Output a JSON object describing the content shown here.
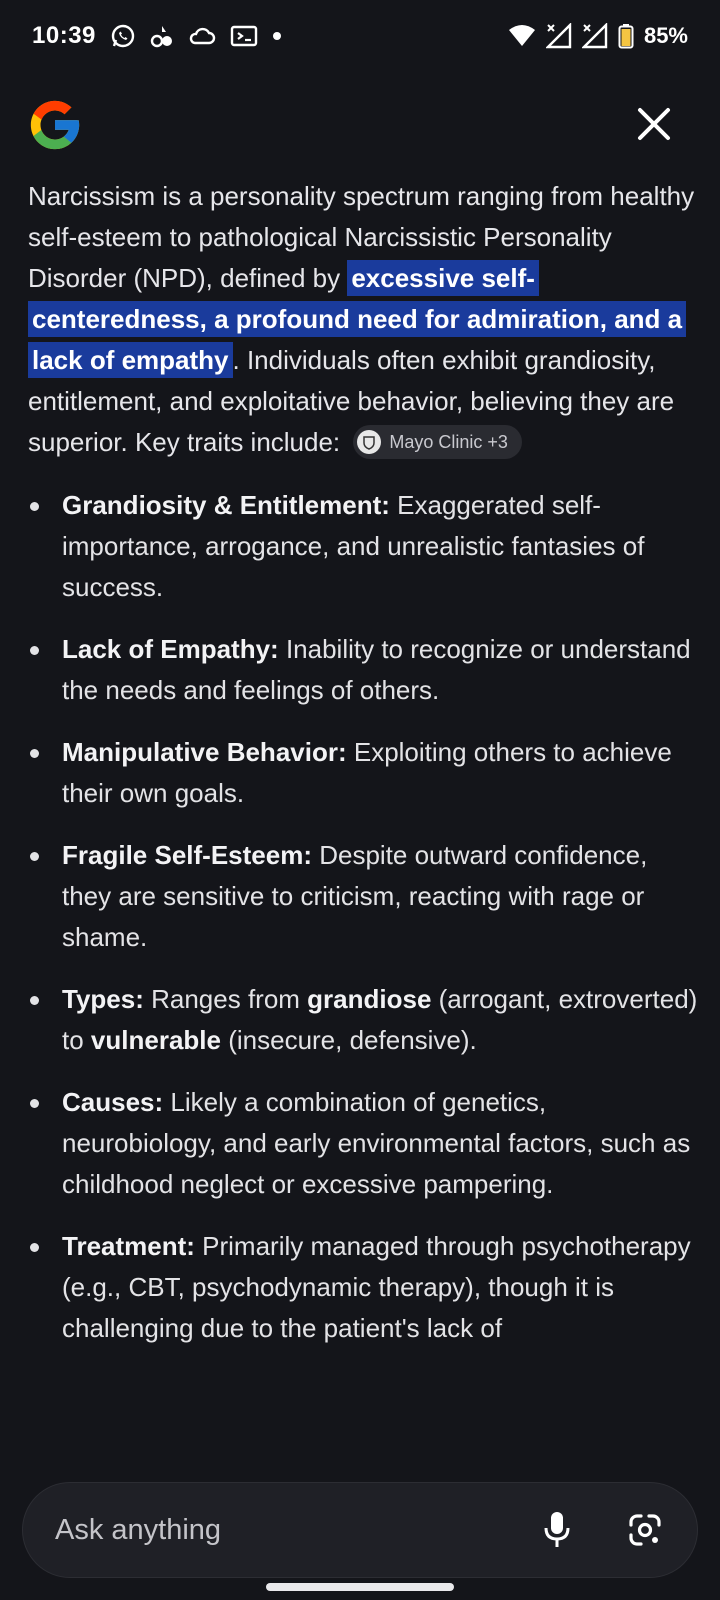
{
  "status_bar": {
    "time": "10:39",
    "battery": "85%",
    "icons": [
      "whatsapp-icon",
      "app-icon",
      "cloud-icon",
      "cast-icon",
      "dot-icon",
      "wifi-icon",
      "signal-icon",
      "signal-icon",
      "battery-icon"
    ]
  },
  "header": {
    "logo": "google-logo",
    "close": "close-icon"
  },
  "answer": {
    "intro_before": "Narcissism is a personality spectrum ranging from healthy self-esteem to pathological Narcissistic Personality Disorder (NPD), defined by ",
    "intro_highlight": "excessive self-centeredness, a profound need for admiration, and a lack of empathy",
    "intro_after": ". Individuals often exhibit grandiosity, entitlement, and exploitative behavior, believing they are superior. Key traits include:",
    "source_chip": "Mayo Clinic +3",
    "traits": [
      {
        "title": "Grandiosity & Entitlement:",
        "text": " Exaggerated self-importance, arrogance, and unrealistic fantasies of success."
      },
      {
        "title": "Lack of Empathy:",
        "text": " Inability to recognize or understand the needs and feelings of others."
      },
      {
        "title": "Manipulative Behavior:",
        "text": " Exploiting others to achieve their own goals."
      },
      {
        "title": "Fragile Self-Esteem:",
        "text": " Despite outward confidence, they are sensitive to criticism, reacting with rage or shame."
      },
      {
        "title": "Types:",
        "text_1": " Ranges from ",
        "bold_1": "grandiose",
        "text_2": " (arrogant, extroverted) to ",
        "bold_2": "vulnerable",
        "text_3": " (insecure, defensive)."
      },
      {
        "title": "Causes:",
        "text": " Likely a combination of genetics, neurobiology, and early environmental factors, such as childhood neglect or excessive pampering."
      },
      {
        "title": "Treatment:",
        "text": " Primarily managed through psychotherapy (e.g., CBT, psychodynamic therapy), though it is challenging due to the patient's lack of"
      }
    ]
  },
  "ask_bar": {
    "placeholder": "Ask anything",
    "mic": "microphone-icon",
    "lens": "google-lens-icon"
  },
  "colors": {
    "background": "#14151a",
    "highlight": "#1a3b9c",
    "text": "#e3e3e6"
  }
}
